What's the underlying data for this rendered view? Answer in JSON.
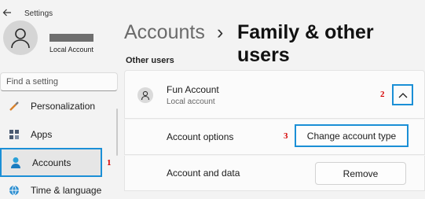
{
  "window": {
    "title": "Settings"
  },
  "profile": {
    "account_type": "Local Account"
  },
  "search": {
    "placeholder": "Find a setting"
  },
  "sidebar": {
    "items": [
      {
        "label": "Personalization",
        "icon": "brush-icon"
      },
      {
        "label": "Apps",
        "icon": "apps-icon"
      },
      {
        "label": "Accounts",
        "icon": "person-icon",
        "selected": true
      },
      {
        "label": "Time & language",
        "icon": "globe-clock-icon"
      }
    ]
  },
  "header": {
    "root": "Accounts",
    "separator": "›",
    "current": "Family & other users"
  },
  "section": {
    "title": "Other users"
  },
  "user_card": {
    "name": "Fun Account",
    "subtitle": "Local account"
  },
  "rows": {
    "account_options": {
      "label": "Account options",
      "button": "Change account type"
    },
    "account_data": {
      "label": "Account and data",
      "button": "Remove"
    }
  },
  "annotations": {
    "step1": "1",
    "step2": "2",
    "step3": "3"
  },
  "colors": {
    "highlight": "#1b8fd6",
    "annotation": "#d60000",
    "background": "#f3f3f3",
    "card": "#fbfbfb"
  }
}
